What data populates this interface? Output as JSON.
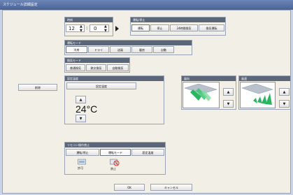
{
  "window": {
    "title": "スケジュール詳細設定"
  },
  "delete_label": "削除",
  "time": {
    "header": "時刻",
    "hour": "12",
    "minute": "0"
  },
  "run_stop": {
    "header": "運転/停止",
    "buttons": [
      "運転",
      "停止",
      "24時間換気",
      "換気運転"
    ]
  },
  "op_mode": {
    "header": "運転モード",
    "buttons": [
      "冷房",
      "ドライ",
      "送風",
      "暖房",
      "自動"
    ]
  },
  "vent_mode": {
    "header": "換気モード",
    "buttons": [
      "普通換気",
      "熱交換気",
      "自動換気"
    ]
  },
  "setpoint": {
    "header": "設定温度",
    "label": "設定温度",
    "value": "24°C"
  },
  "airflow": {
    "header": "風向"
  },
  "fanspeed": {
    "header": "風速"
  },
  "remote": {
    "header": "リモコン操作禁止",
    "buttons": [
      "運転/停止",
      "運転モード",
      "設定温度"
    ],
    "status_allow": "許可",
    "status_prohibit": "禁止"
  },
  "footer": {
    "ok": "OK",
    "cancel": "キャンセル"
  },
  "colors": {
    "titlebar": "#4a6396",
    "header": "#5b6678",
    "panel_bg": "#f1efe6",
    "accent_green": "#22b05a"
  }
}
